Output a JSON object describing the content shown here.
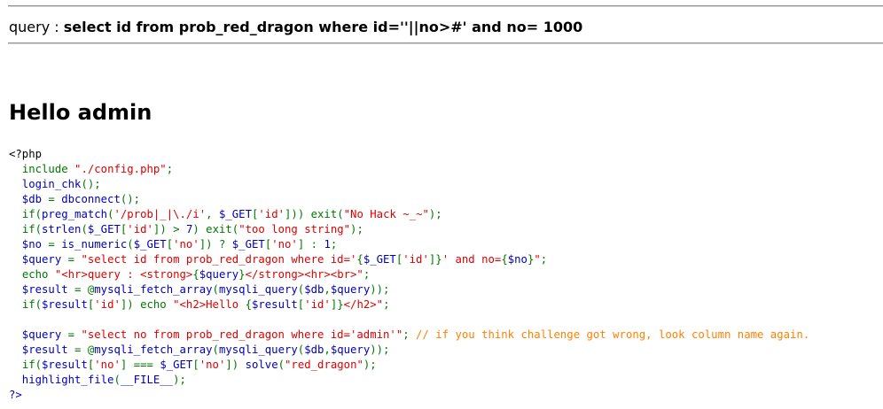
{
  "query_line": {
    "label": "query : ",
    "value": "select id from prob_red_dragon where id=''||no>#' and no= 1000"
  },
  "greeting": "Hello admin",
  "colors": {
    "html": "#000000",
    "default": "#0000BB",
    "keyword": "#007700",
    "string": "#DD0000",
    "comment": "#FF8000"
  },
  "source_lines": [
    [
      [
        "html",
        "<?php"
      ]
    ],
    [
      [
        "def",
        "  "
      ],
      [
        "kw",
        "include "
      ],
      [
        "str",
        "\"./config.php\""
      ],
      [
        "kw",
        ";"
      ]
    ],
    [
      [
        "def",
        "  login_chk"
      ],
      [
        "kw",
        "();"
      ]
    ],
    [
      [
        "def",
        "  $db "
      ],
      [
        "kw",
        "= "
      ],
      [
        "def",
        "dbconnect"
      ],
      [
        "kw",
        "();"
      ]
    ],
    [
      [
        "def",
        "  "
      ],
      [
        "kw",
        "if("
      ],
      [
        "def",
        "preg_match"
      ],
      [
        "kw",
        "("
      ],
      [
        "str",
        "'/prob|_|\\./i'"
      ],
      [
        "kw",
        ", "
      ],
      [
        "def",
        "$_GET"
      ],
      [
        "kw",
        "["
      ],
      [
        "str",
        "'id'"
      ],
      [
        "kw",
        "])) exit("
      ],
      [
        "str",
        "\"No Hack ~_~\""
      ],
      [
        "kw",
        ");"
      ]
    ],
    [
      [
        "def",
        "  "
      ],
      [
        "kw",
        "if("
      ],
      [
        "def",
        "strlen"
      ],
      [
        "kw",
        "("
      ],
      [
        "def",
        "$_GET"
      ],
      [
        "kw",
        "["
      ],
      [
        "str",
        "'id'"
      ],
      [
        "kw",
        "]) > "
      ],
      [
        "def",
        "7"
      ],
      [
        "kw",
        ") exit("
      ],
      [
        "str",
        "\"too long string\""
      ],
      [
        "kw",
        ");"
      ]
    ],
    [
      [
        "def",
        "  $no "
      ],
      [
        "kw",
        "= "
      ],
      [
        "def",
        "is_numeric"
      ],
      [
        "kw",
        "("
      ],
      [
        "def",
        "$_GET"
      ],
      [
        "kw",
        "["
      ],
      [
        "str",
        "'no'"
      ],
      [
        "kw",
        "]) ? "
      ],
      [
        "def",
        "$_GET"
      ],
      [
        "kw",
        "["
      ],
      [
        "str",
        "'no'"
      ],
      [
        "kw",
        "] : "
      ],
      [
        "def",
        "1"
      ],
      [
        "kw",
        ";"
      ]
    ],
    [
      [
        "def",
        "  $query "
      ],
      [
        "kw",
        "= "
      ],
      [
        "str",
        "\"select id from prob_red_dragon where id='"
      ],
      [
        "kw",
        "{"
      ],
      [
        "def",
        "$_GET"
      ],
      [
        "kw",
        "["
      ],
      [
        "str",
        "'id'"
      ],
      [
        "kw",
        "]}"
      ],
      [
        "str",
        "' and no="
      ],
      [
        "kw",
        "{"
      ],
      [
        "def",
        "$no"
      ],
      [
        "kw",
        "}"
      ],
      [
        "str",
        "\""
      ],
      [
        "kw",
        ";"
      ]
    ],
    [
      [
        "def",
        "  "
      ],
      [
        "kw",
        "echo "
      ],
      [
        "str",
        "\"<hr>query : <strong>"
      ],
      [
        "kw",
        "{"
      ],
      [
        "def",
        "$query"
      ],
      [
        "kw",
        "}"
      ],
      [
        "str",
        "</strong><hr><br>\""
      ],
      [
        "kw",
        ";"
      ]
    ],
    [
      [
        "def",
        "  $result "
      ],
      [
        "kw",
        "= @"
      ],
      [
        "def",
        "mysqli_fetch_array"
      ],
      [
        "kw",
        "("
      ],
      [
        "def",
        "mysqli_query"
      ],
      [
        "kw",
        "("
      ],
      [
        "def",
        "$db"
      ],
      [
        "kw",
        ","
      ],
      [
        "def",
        "$query"
      ],
      [
        "kw",
        "));"
      ]
    ],
    [
      [
        "def",
        "  "
      ],
      [
        "kw",
        "if("
      ],
      [
        "def",
        "$result"
      ],
      [
        "kw",
        "["
      ],
      [
        "str",
        "'id'"
      ],
      [
        "kw",
        "]) echo "
      ],
      [
        "str",
        "\"<h2>Hello "
      ],
      [
        "kw",
        "{"
      ],
      [
        "def",
        "$result"
      ],
      [
        "kw",
        "["
      ],
      [
        "str",
        "'id'"
      ],
      [
        "kw",
        "]}"
      ],
      [
        "str",
        "</h2>\""
      ],
      [
        "kw",
        ";"
      ]
    ],
    [
      [
        "def",
        " "
      ]
    ],
    [
      [
        "def",
        "  $query "
      ],
      [
        "kw",
        "= "
      ],
      [
        "str",
        "\"select no from prob_red_dragon where id='admin'\""
      ],
      [
        "kw",
        "; "
      ],
      [
        "cmt",
        "// if you think challenge got wrong, look column name again."
      ]
    ],
    [
      [
        "def",
        "  $result "
      ],
      [
        "kw",
        "= @"
      ],
      [
        "def",
        "mysqli_fetch_array"
      ],
      [
        "kw",
        "("
      ],
      [
        "def",
        "mysqli_query"
      ],
      [
        "kw",
        "("
      ],
      [
        "def",
        "$db"
      ],
      [
        "kw",
        ","
      ],
      [
        "def",
        "$query"
      ],
      [
        "kw",
        "));"
      ]
    ],
    [
      [
        "def",
        "  "
      ],
      [
        "kw",
        "if("
      ],
      [
        "def",
        "$result"
      ],
      [
        "kw",
        "["
      ],
      [
        "str",
        "'no'"
      ],
      [
        "kw",
        "] === "
      ],
      [
        "def",
        "$_GET"
      ],
      [
        "kw",
        "["
      ],
      [
        "str",
        "'no'"
      ],
      [
        "kw",
        "]) "
      ],
      [
        "def",
        "solve"
      ],
      [
        "kw",
        "("
      ],
      [
        "str",
        "\"red_dragon\""
      ],
      [
        "kw",
        ");"
      ]
    ],
    [
      [
        "def",
        "  highlight_file"
      ],
      [
        "kw",
        "("
      ],
      [
        "def",
        "__FILE__"
      ],
      [
        "kw",
        ");"
      ]
    ],
    [
      [
        "def",
        "?>"
      ]
    ]
  ]
}
